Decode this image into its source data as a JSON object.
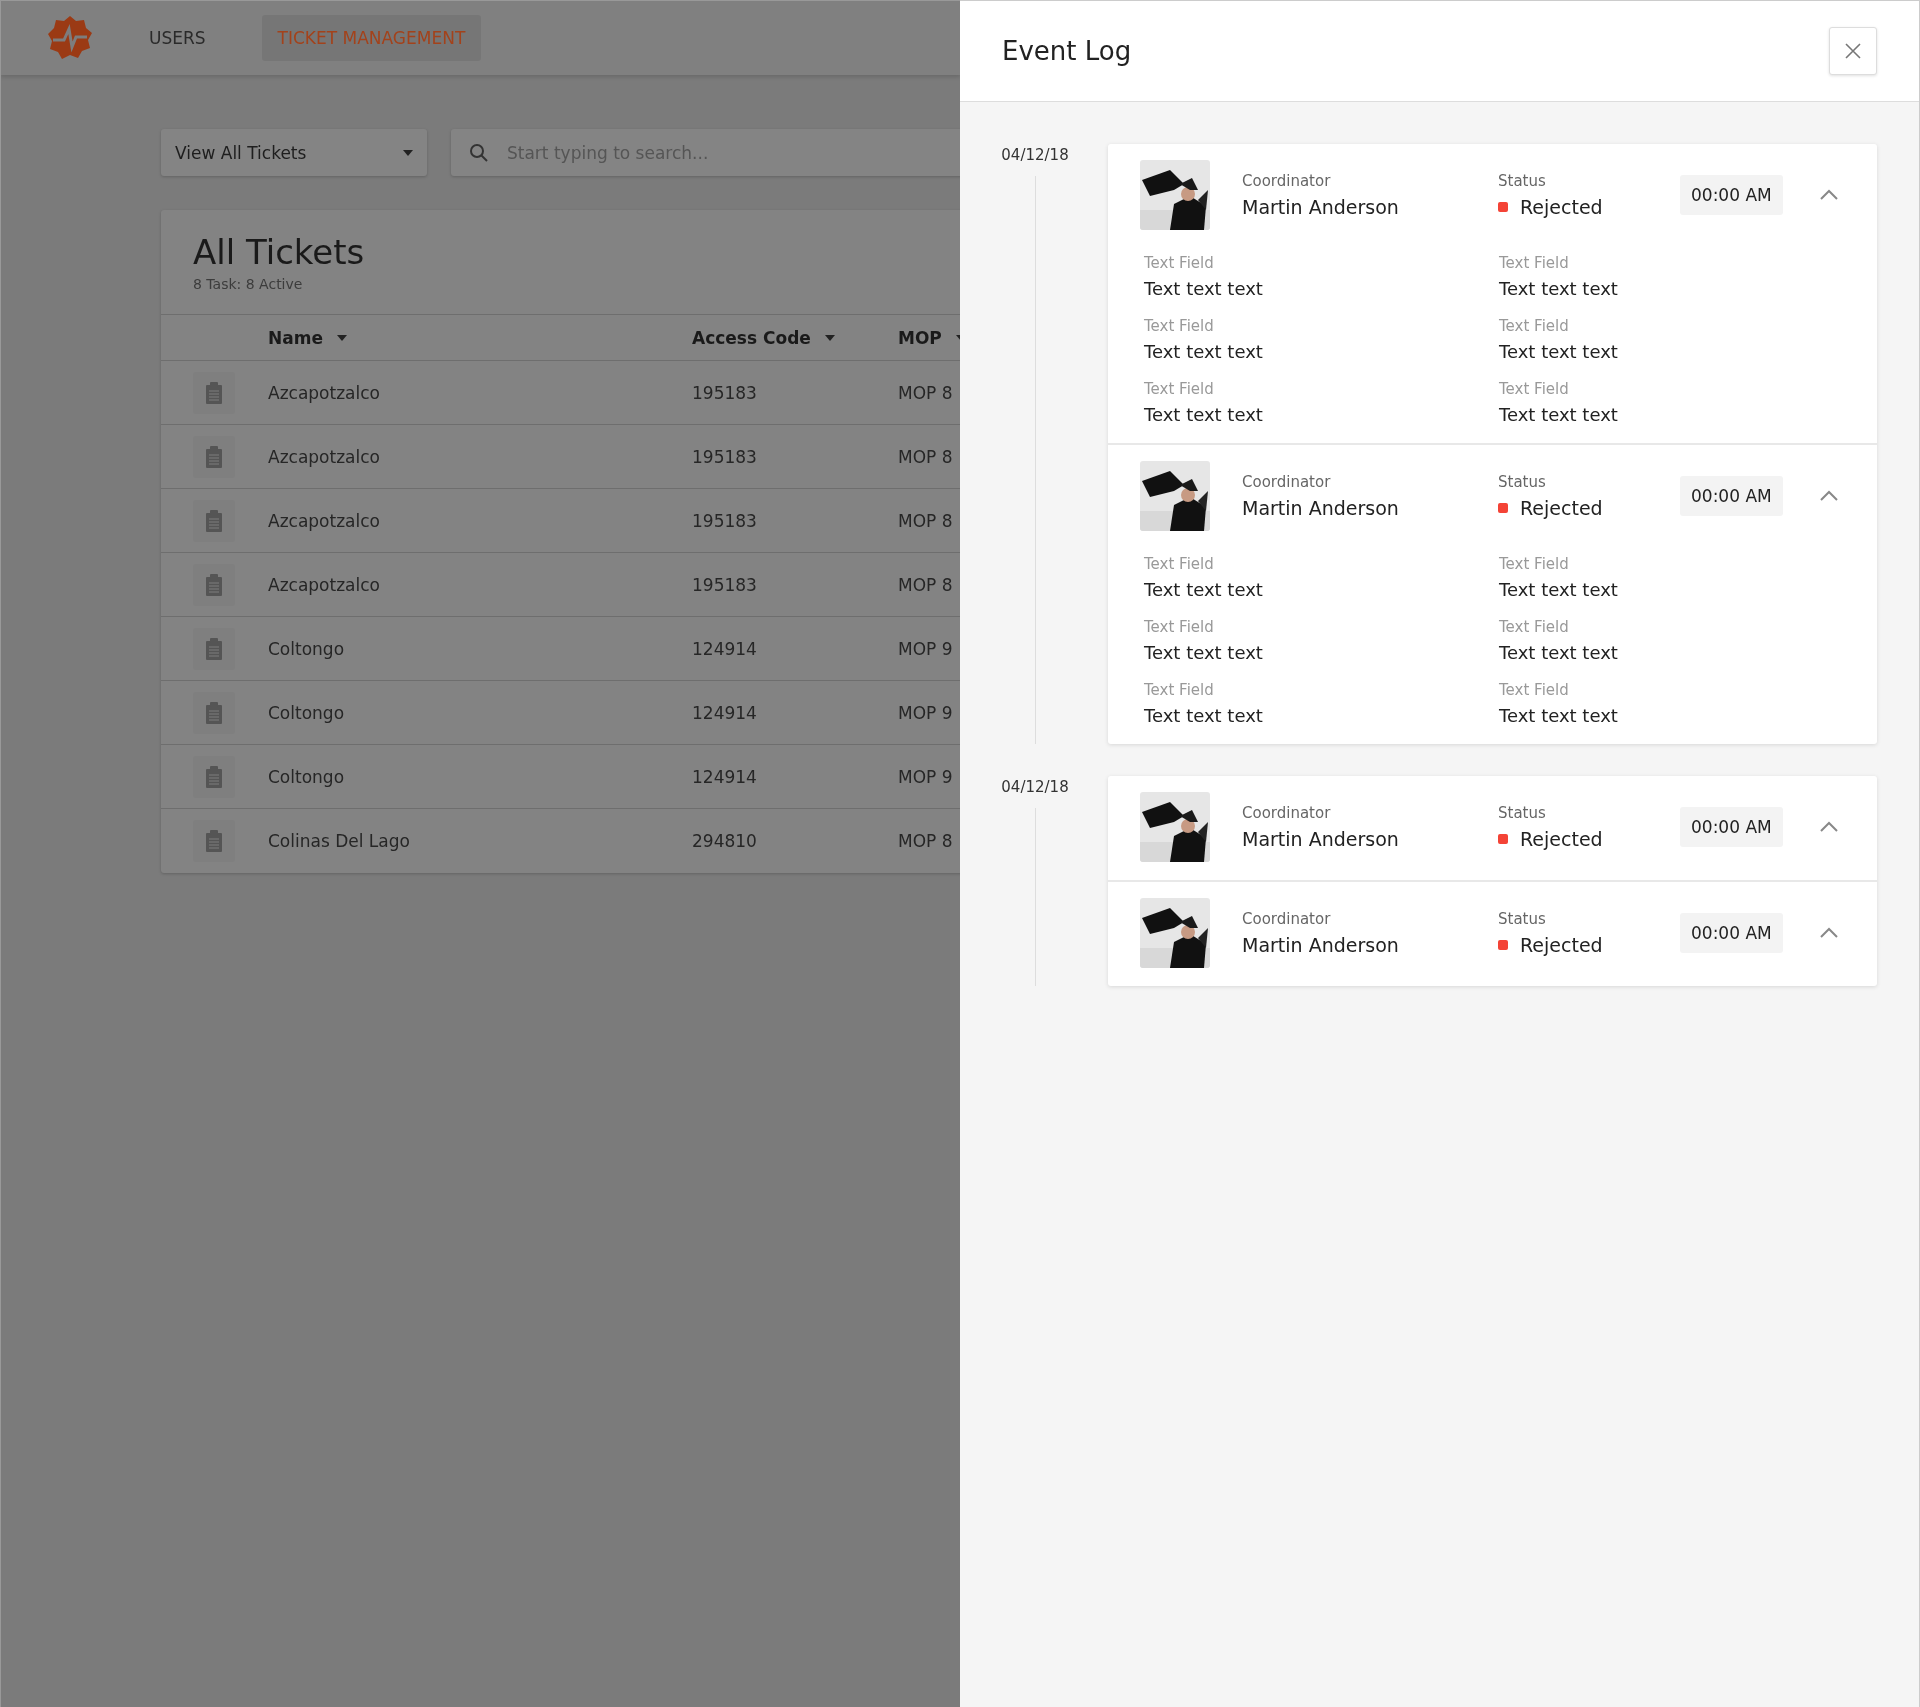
{
  "nav": {
    "tabs": [
      {
        "label": "USERS",
        "selected": false
      },
      {
        "label": "TICKET MANAGEMENT",
        "selected": true
      }
    ]
  },
  "filter": {
    "value": "View All Tickets"
  },
  "search": {
    "placeholder": "Start typing to search..."
  },
  "tickets": {
    "title": "All Tickets",
    "subtitle": "8 Task: 8 Active",
    "columns": [
      "Name",
      "Access Code",
      "MOP"
    ],
    "rows": [
      {
        "name": "Azcapotzalco",
        "code": "195183",
        "mop": "MOP 8"
      },
      {
        "name": "Azcapotzalco",
        "code": "195183",
        "mop": "MOP 8"
      },
      {
        "name": "Azcapotzalco",
        "code": "195183",
        "mop": "MOP 8"
      },
      {
        "name": "Azcapotzalco",
        "code": "195183",
        "mop": "MOP 8"
      },
      {
        "name": "Coltongo",
        "code": "124914",
        "mop": "MOP 9"
      },
      {
        "name": "Coltongo",
        "code": "124914",
        "mop": "MOP 9"
      },
      {
        "name": "Coltongo",
        "code": "124914",
        "mop": "MOP 9"
      },
      {
        "name": "Colinas Del Lago",
        "code": "294810",
        "mop": "MOP 8"
      }
    ]
  },
  "event_log": {
    "title": "Event Log",
    "groups": [
      {
        "date": "04/12/18",
        "events": [
          {
            "role_label": "Coordinator",
            "name": "Martin Anderson",
            "status_label": "Status",
            "status": "Rejected",
            "color": "#f44336",
            "time": "00:00 AM",
            "fields": [
              {
                "label": "Text Field",
                "value": "Text text text"
              },
              {
                "label": "Text Field",
                "value": "Text text text"
              },
              {
                "label": "Text Field",
                "value": "Text text text"
              },
              {
                "label": "Text Field",
                "value": "Text text text"
              },
              {
                "label": "Text Field",
                "value": "Text text text"
              },
              {
                "label": "Text Field",
                "value": "Text text text"
              }
            ]
          },
          {
            "role_label": "Coordinator",
            "name": "Martin Anderson",
            "status_label": "Status",
            "status": "Rejected",
            "color": "#f44336",
            "time": "00:00 AM",
            "fields": [
              {
                "label": "Text Field",
                "value": "Text text text"
              },
              {
                "label": "Text Field",
                "value": "Text text text"
              },
              {
                "label": "Text Field",
                "value": "Text text text"
              },
              {
                "label": "Text Field",
                "value": "Text text text"
              },
              {
                "label": "Text Field",
                "value": "Text text text"
              },
              {
                "label": "Text Field",
                "value": "Text text text"
              }
            ]
          }
        ]
      },
      {
        "date": "04/12/18",
        "events": [
          {
            "role_label": "Coordinator",
            "name": "Martin Anderson",
            "status_label": "Status",
            "status": "Rejected",
            "color": "#f44336",
            "time": "00:00 AM"
          },
          {
            "role_label": "Coordinator",
            "name": "Martin Anderson",
            "status_label": "Status",
            "status": "Rejected",
            "color": "#f44336",
            "time": "00:00 AM"
          }
        ]
      }
    ]
  }
}
